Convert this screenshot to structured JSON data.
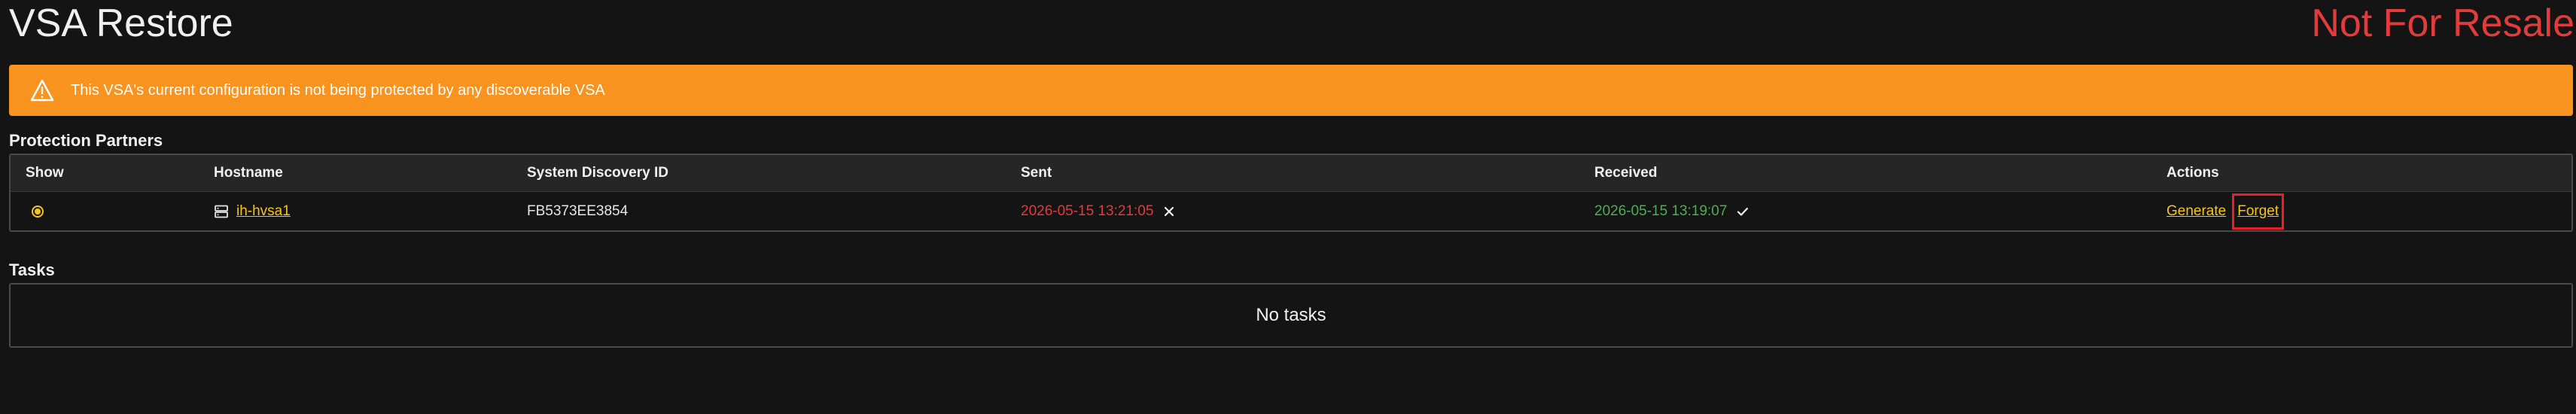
{
  "page": {
    "title": "VSA Restore",
    "not_for_resale": "Not For Resale"
  },
  "alert": {
    "icon": "warning-triangle-icon",
    "message": "This VSA's current configuration is not being protected by any discoverable VSA",
    "color": "#f7931e"
  },
  "protection_partners": {
    "label": "Protection Partners",
    "columns": {
      "show": "Show",
      "hostname": "Hostname",
      "discovery_id": "System Discovery ID",
      "sent": "Sent",
      "received": "Received",
      "actions": "Actions"
    },
    "rows": [
      {
        "show_selected": true,
        "hostname_icon": "server-icon",
        "hostname": "ih-hvsa1",
        "discovery_id": "FB5373EE3854",
        "sent": "2026-05-15 13:21:05",
        "sent_status_icon": "x-icon",
        "received": "2026-05-15 13:19:07",
        "received_status_icon": "check-icon",
        "actions": {
          "generate": "Generate",
          "forget": "Forget"
        }
      }
    ]
  },
  "tasks": {
    "label": "Tasks",
    "empty_text": "No tasks"
  },
  "colors": {
    "background": "#141414",
    "accent": "#f5c518",
    "error": "#e23b3b",
    "success": "#4caf50",
    "highlight_box": "#e8202a"
  }
}
